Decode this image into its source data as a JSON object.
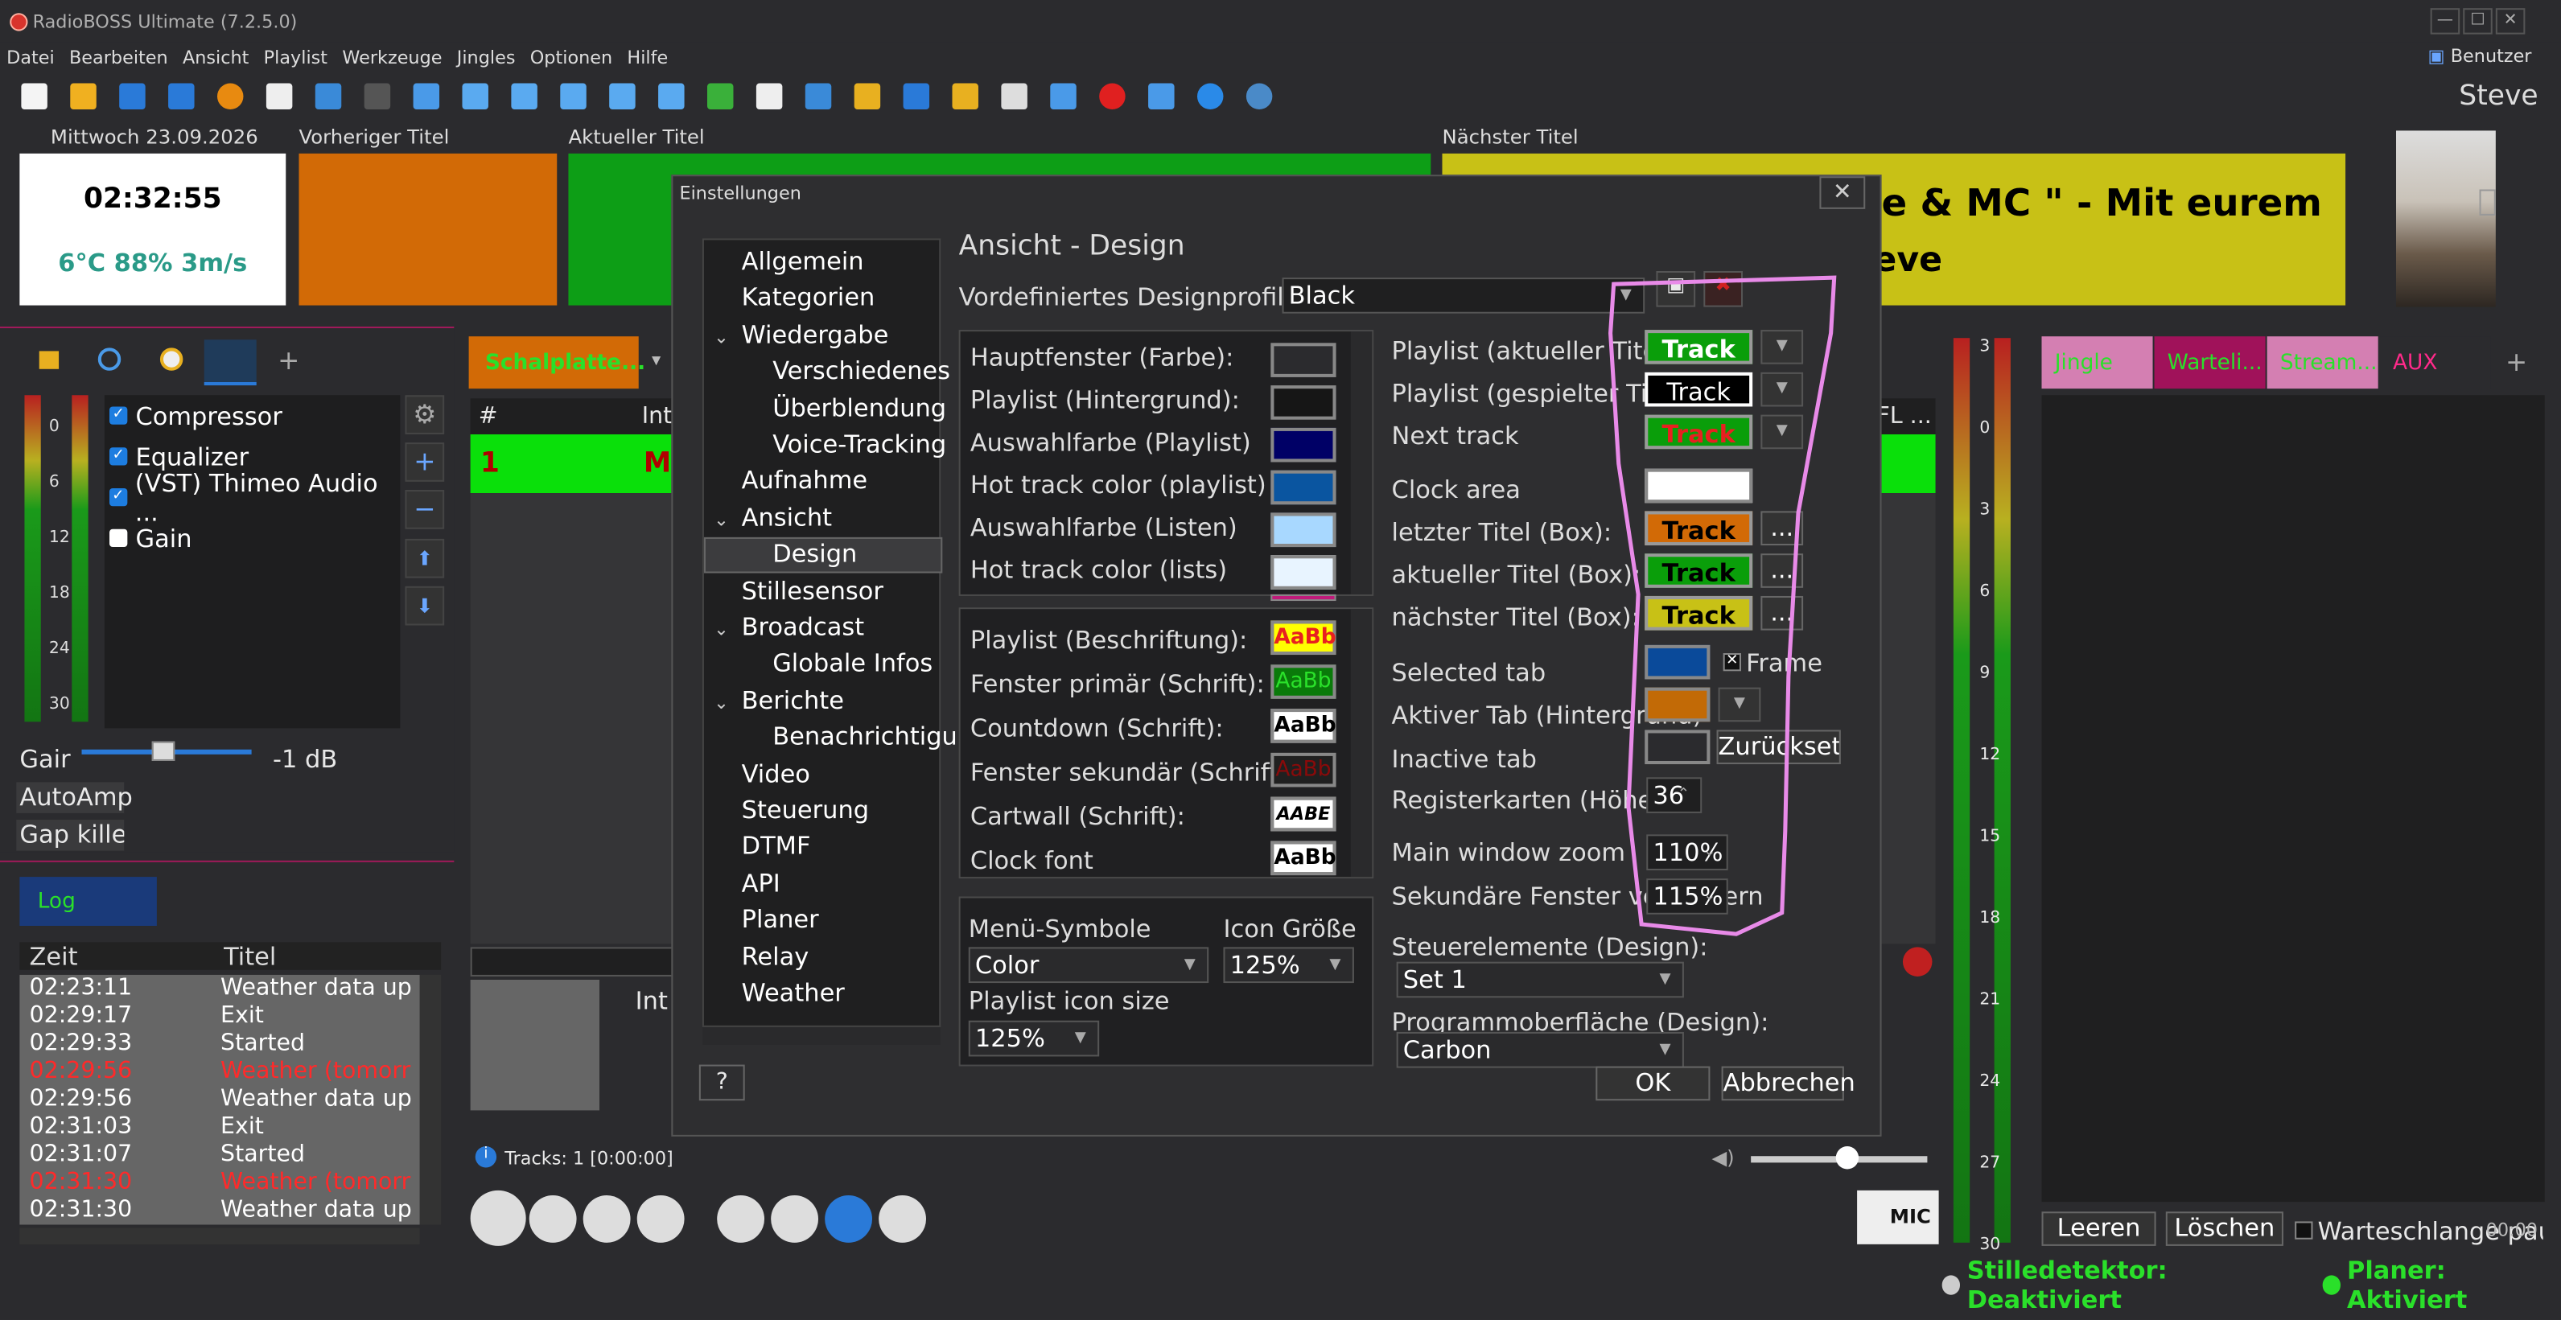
{
  "window": {
    "title": "RadioBOSS Ultimate (7.2.5.0)",
    "min": "—",
    "max": "☐",
    "close": "✕"
  },
  "menu": [
    "Datei",
    "Bearbeiten",
    "Ansicht",
    "Playlist",
    "Werkzeuge",
    "Jingles",
    "Optionen",
    "Hilfe"
  ],
  "user": {
    "label": "Benutzer",
    "name": "Steve"
  },
  "headers": {
    "date": "Mittwoch 23.09.2026",
    "prev": "Vorheriger Titel",
    "current": "Aktueller Titel",
    "next": "Nächster Titel"
  },
  "clock": {
    "time": "02:32:55",
    "weather": "6°C 88% 3m/s"
  },
  "next_text": {
    "line1": "tte & MC \" - Mit eurem",
    "line2": "eve"
  },
  "fx": {
    "items": [
      {
        "label": "Compressor",
        "on": true
      },
      {
        "label": "Equalizer",
        "on": true
      },
      {
        "label": "(VST) Thimeo Audio ...",
        "on": true
      },
      {
        "label": "Gain",
        "on": false
      }
    ],
    "gain_label": "Gair",
    "gain_value": "-1 dB",
    "autoamp": "AutoAmp",
    "gapkiller": "Gap killer"
  },
  "meter_left": [
    "0",
    "6",
    "12",
    "18",
    "24",
    "30"
  ],
  "log": {
    "tab": "Log",
    "col_time": "Zeit",
    "col_title": "Titel",
    "rows": [
      {
        "t": "02:23:11",
        "m": "Weather data up",
        "red": false
      },
      {
        "t": "02:29:17",
        "m": "Exit",
        "red": false
      },
      {
        "t": "02:29:33",
        "m": "Started",
        "red": false
      },
      {
        "t": "02:29:56",
        "m": "Weather (tomorr",
        "red": true
      },
      {
        "t": "02:29:56",
        "m": "Weather data up",
        "red": false
      },
      {
        "t": "02:31:03",
        "m": "Exit",
        "red": false
      },
      {
        "t": "02:31:07",
        "m": "Started",
        "red": false
      },
      {
        "t": "02:31:30",
        "m": "Weather (tomorr",
        "red": true
      },
      {
        "t": "02:31:30",
        "m": "Weather data up",
        "red": false
      }
    ]
  },
  "playlist": {
    "tab": "Schalplatte...",
    "col_num": "#",
    "col_in": "Int",
    "row_num": "1",
    "row_m": "M",
    "col_fl": "FL ...",
    "tracks": "Tracks: 1 [0:00:00]",
    "int_label": "Int",
    "mic": "MIC"
  },
  "right": {
    "tabs": [
      "Jingle",
      "Warteli...",
      "Stream...",
      "AUX"
    ],
    "buttons": {
      "leeren": "Leeren",
      "loeschen": "Löschen",
      "warteschlange": "Warteschlange pau"
    },
    "time": "00:00",
    "scale": [
      "3",
      "0",
      "3",
      "6",
      "9",
      "12",
      "15",
      "18",
      "21",
      "24",
      "27",
      "30"
    ]
  },
  "status": {
    "silence": "Stilledetektor: Deaktiviert",
    "planer": "Planer: Aktiviert"
  },
  "dialog": {
    "title": "Einstellungen",
    "section": "Ansicht - Design",
    "profile_label": "Vordefiniertes Designprofil",
    "profile_value": "Black",
    "tree": [
      "Allgemein",
      "Kategorien",
      "Wiedergabe",
      "Verschiedenes",
      "Überblendung",
      "Voice-Tracking",
      "Aufnahme",
      "Ansicht",
      "Design",
      "Stillesensor",
      "Broadcast",
      "Globale Infos",
      "Berichte",
      "Benachrichtigu",
      "Video",
      "Steuerung",
      "DTMF",
      "API",
      "Planer",
      "Relay",
      "Weather"
    ],
    "colors": [
      "Hauptfenster (Farbe):",
      "Playlist (Hintergrund):",
      "Auswahlfarbe (Playlist)",
      "Hot track color (playlist)",
      "Auswahlfarbe (Listen)",
      "Hot track color (lists)"
    ],
    "fonts": [
      "Playlist (Beschriftung):",
      "Fenster primär (Schrift):",
      "Countdown (Schrift):",
      "Fenster sekundär (Schrift)",
      "Cartwall (Schrift):",
      "Clock font"
    ],
    "font_sample": "AaBb",
    "cart_sample": "AABE",
    "menu_icons_label": "Menü-Symbole",
    "menu_icons_value": "Color",
    "icon_size_label": "Icon Größe",
    "icon_size_value": "125%",
    "pl_icon_label": "Playlist icon size",
    "pl_icon_value": "125%",
    "right_rows": [
      "Playlist (aktueller Titel)",
      "Playlist (gespielter Titel)",
      "Next track",
      "Clock area",
      "letzter Titel (Box):",
      "aktueller Titel (Box):",
      "nächster Titel (Box):",
      "Selected tab",
      "Aktiver Tab (Hintergrund)",
      "Inactive tab",
      "Registerkarten (Höhe)"
    ],
    "track": "Track",
    "frame": "Frame",
    "reset": "Zurücksetzen",
    "tab_height": "36",
    "zoom_label": "Main window zoom",
    "zoom_value": "110%",
    "sec_label": "Sekundäre Fenster vergrößern",
    "sec_value": "115%",
    "controls_label": "Steuerelemente (Design):",
    "controls_value": "Set 1",
    "surface_label": "Programmoberfläche (Design):",
    "surface_value": "Carbon",
    "ok": "OK",
    "cancel": "Abbrechen",
    "help": "?",
    "more": "..."
  }
}
